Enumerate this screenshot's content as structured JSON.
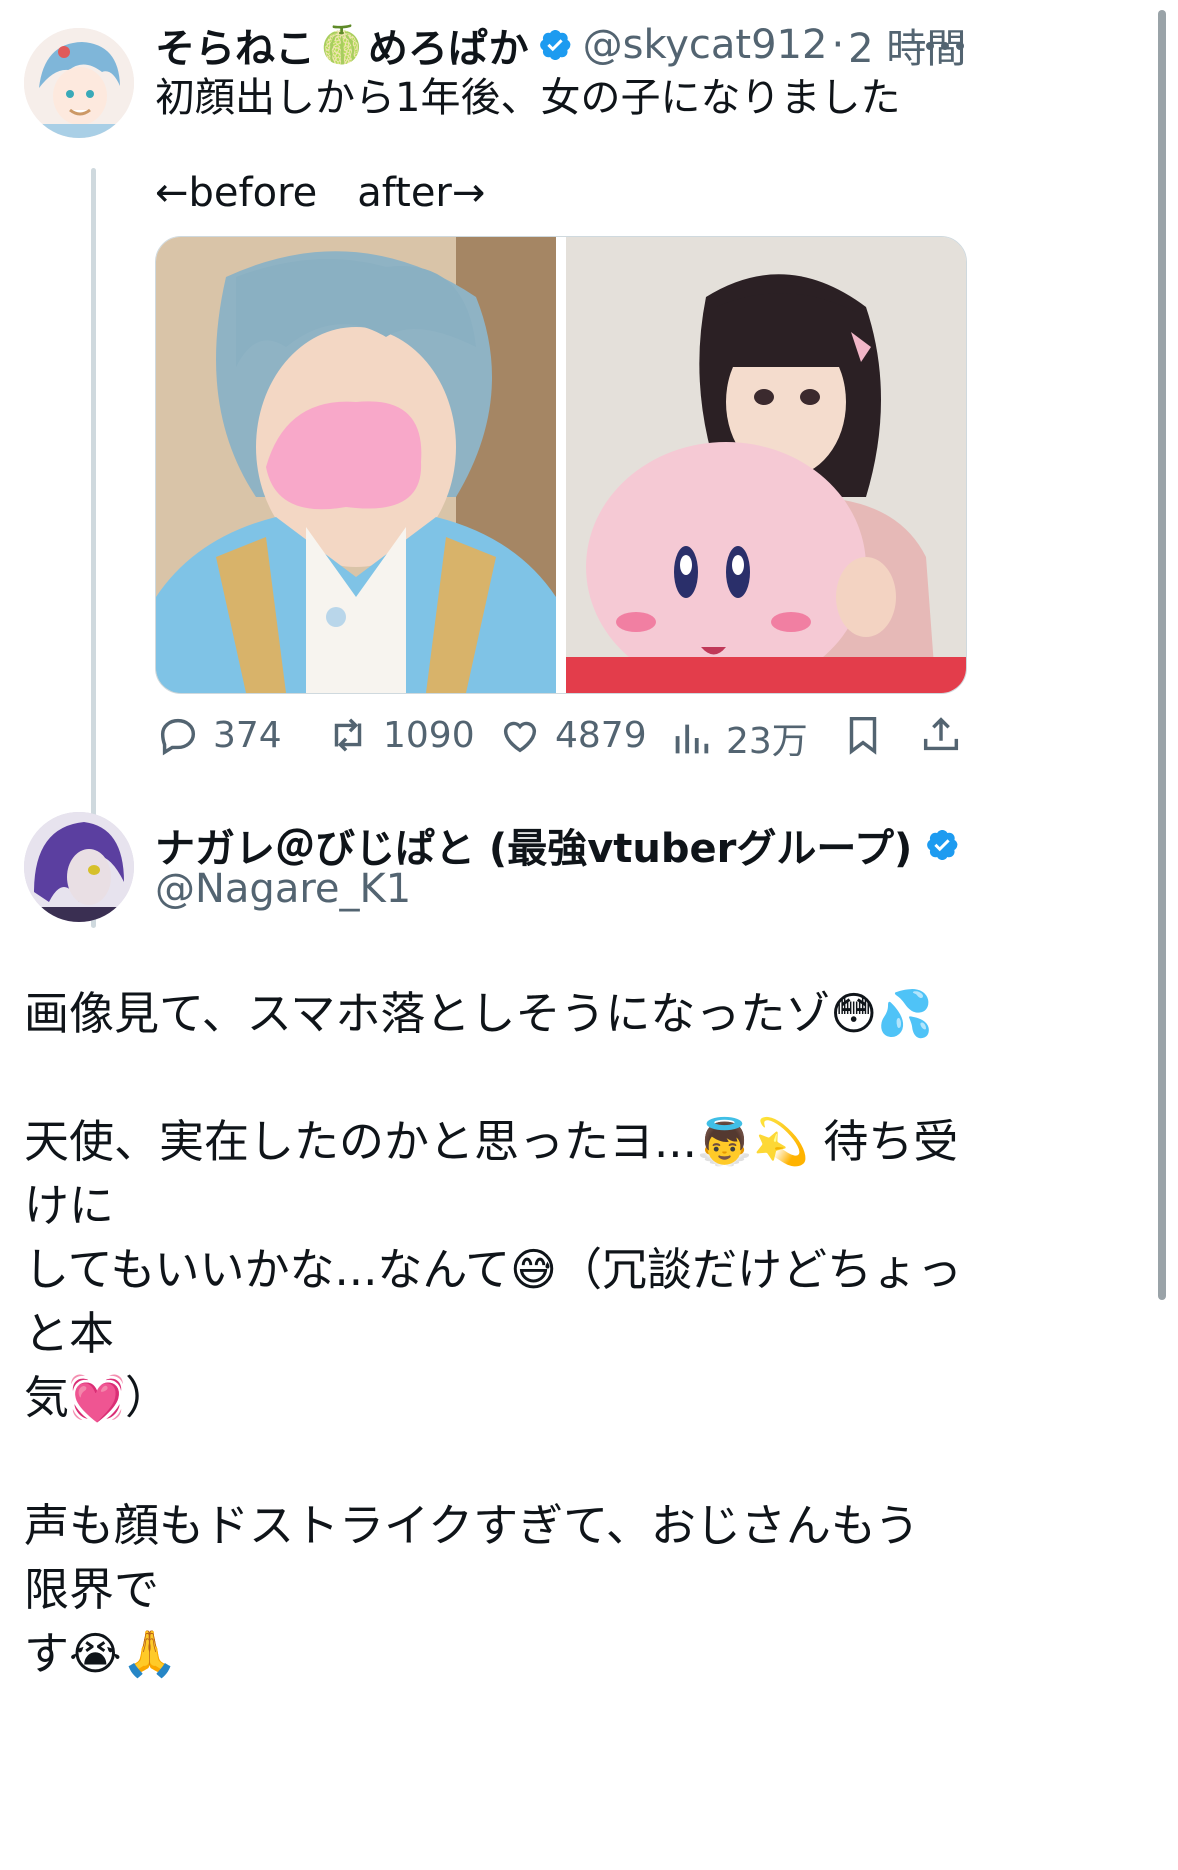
{
  "tweet": {
    "display_name": "そらねこ",
    "display_name_emoji": "🍈",
    "display_name_suffix": "めろぱか",
    "handle": "@skycat912",
    "separator": "·",
    "time": "2 時間",
    "more_icon": "more-dots-icon",
    "text_line1": "初顔出しから1年後、女の子になりました",
    "text_line2": "←before　after→",
    "stats": {
      "replies": "374",
      "retweets": "1090",
      "likes": "4879",
      "views": "23万"
    }
  },
  "reply": {
    "display_name": "ナガレ＠びじぱと (最強vtuberグループ)",
    "handle": "@Nagare_K1",
    "body": "画像見て、スマホ落としそうになったゾ😳💦\n\n天使、実在したのかと思ったヨ...👼💫 待ち受けに\nしてもいいかな...なんて😅（冗談だけどちょっと本\n気💓）\n\n声も顔もドストライクすぎて、おじさんもう限界で\nす😭🙏"
  },
  "colors": {
    "verified": "#1d9bf0",
    "secondary_text": "#536471",
    "thread_line": "#cfd9de",
    "mask_pink": "#f8a8c9"
  }
}
